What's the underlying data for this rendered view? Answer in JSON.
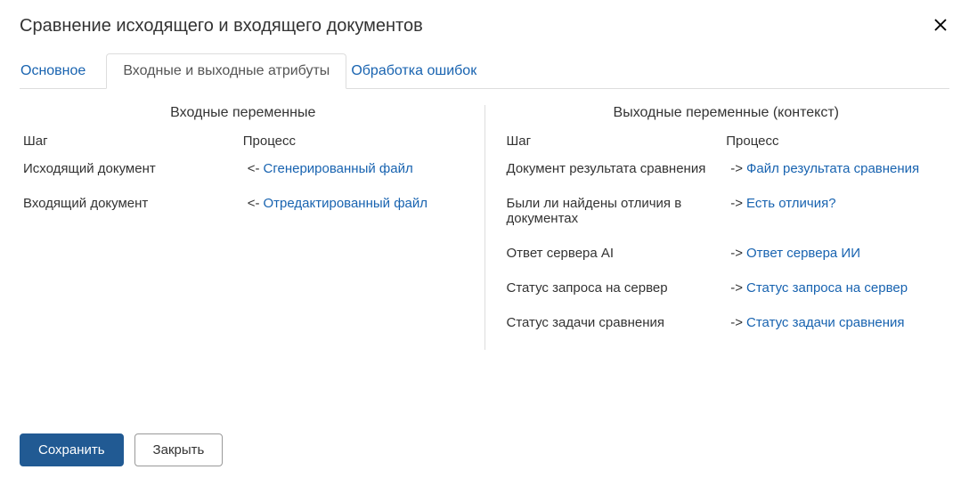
{
  "dialog": {
    "title": "Сравнение исходящего и входящего документов"
  },
  "tabs": {
    "main": "Основное",
    "attrs": "Входные и выходные атрибуты",
    "errors": "Обработка ошибок"
  },
  "left_panel": {
    "title": "Входные переменные",
    "header_step": "Шаг",
    "header_process": "Процесс",
    "rows": [
      {
        "step": "Исходящий документ",
        "arrow": "<-",
        "process": "Сгенерированный файл"
      },
      {
        "step": "Входящий документ",
        "arrow": "<-",
        "process": "Отредактированный файл"
      }
    ]
  },
  "right_panel": {
    "title": "Выходные переменные (контекст)",
    "header_step": "Шаг",
    "header_process": "Процесс",
    "rows": [
      {
        "step": "Документ результата сравнения",
        "arrow": "->",
        "process": "Файл результата сравнения"
      },
      {
        "step": "Были ли найдены отличия в документах",
        "arrow": "->",
        "process": "Есть отличия?"
      },
      {
        "step": "Ответ сервера AI",
        "arrow": "->",
        "process": "Ответ сервера ИИ"
      },
      {
        "step": "Статус запроса на сервер",
        "arrow": "->",
        "process": "Статус запроса на сервер"
      },
      {
        "step": "Статус задачи сравнения",
        "arrow": "->",
        "process": "Статус задачи сравнения"
      }
    ]
  },
  "buttons": {
    "save": "Сохранить",
    "close": "Закрыть"
  }
}
